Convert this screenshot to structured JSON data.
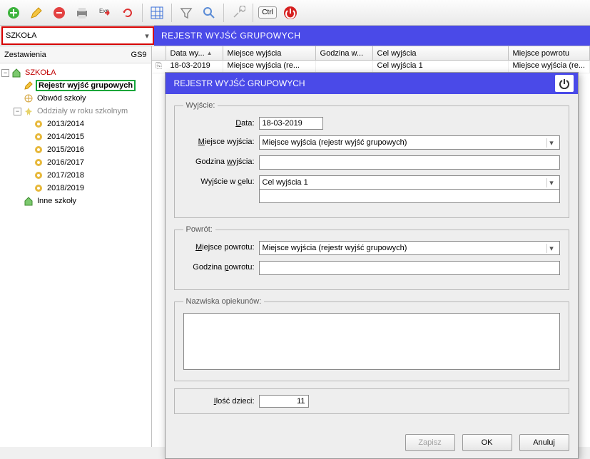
{
  "toolbar": {
    "ctrl_label": "Ctrl"
  },
  "combo": {
    "value": "SZKOŁA"
  },
  "sub_title": "REJESTR WYJŚĆ GRUPOWYCH",
  "left_panel": {
    "title_left": "Zestawienia",
    "title_right": "GS9"
  },
  "tree": {
    "root": "SZKOŁA",
    "items": [
      "Rejestr wyjść grupowych",
      "Obwód szkoły",
      "Oddziały w roku szkolnym"
    ],
    "years": [
      "2013/2014",
      "2014/2015",
      "2015/2016",
      "2016/2017",
      "2017/2018",
      "2018/2019"
    ],
    "last": "Inne szkoły"
  },
  "grid": {
    "headers": [
      "Data wy...",
      "Miejsce wyjścia",
      "Godzina w...",
      "Cel wyjścia",
      "Miejsce powrotu"
    ],
    "row": {
      "date": "18-03-2019",
      "miejsce": "Miejsce wyjścia (re...",
      "godzina": "",
      "cel": "Cel wyjścia 1",
      "powrot": "Miejsce wyjścia (re..."
    }
  },
  "dialog": {
    "title": "REJESTR WYJŚĆ GRUPOWYCH",
    "legend_wyjscie": "Wyjście:",
    "legend_powrot": "Powrót:",
    "legend_nazwiska": "Nazwiska opiekunów:",
    "labels": {
      "data": "Data:",
      "miejsce_wyjscia": "Miejsce wyjścia:",
      "godzina_wyjscia": "Godzina wyjścia:",
      "wyjscie_w_celu": "Wyjście w celu:",
      "miejsce_powrotu": "Miejsce powrotu:",
      "godzina_powrotu": "Godzina powrotu:",
      "ilosc_dzieci": "Ilość dzieci:"
    },
    "values": {
      "data": "18-03-2019",
      "miejsce_wyjscia": "Miejsce wyjścia (rejestr wyjść grupowych)",
      "godzina_wyjscia": "",
      "wyjscie_w_celu": "Cel wyjścia 1",
      "miejsce_powrotu": "Miejsce wyjścia (rejestr wyjść grupowych)",
      "godzina_powrotu": "",
      "nazwiska": "",
      "ilosc_dzieci": "11"
    },
    "buttons": {
      "zapisz": "Zapisz",
      "ok": "OK",
      "anuluj": "Anuluj"
    }
  }
}
